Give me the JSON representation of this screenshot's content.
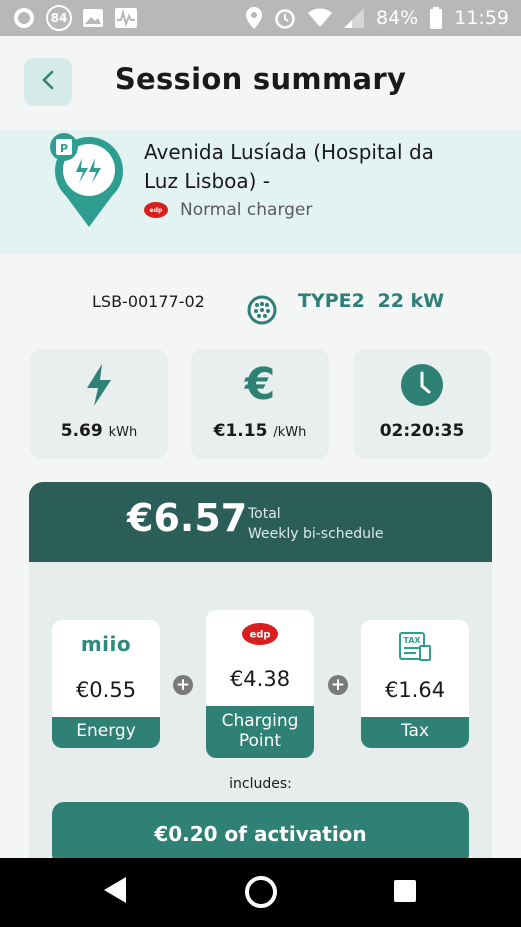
{
  "status_bar": {
    "notification_count": "84",
    "battery": "84%",
    "time": "11:59"
  },
  "header": {
    "title": "Session summary"
  },
  "station": {
    "name_line1": "Avenida Lusíada (Hospital da",
    "name_line2": "Luz Lisboa) -",
    "operator_logo": "edp",
    "charger_type": "Normal charger"
  },
  "connector": {
    "charger_id": "LSB-00177-02",
    "plug_type": "TYPE2",
    "power": "22 kW"
  },
  "stats": {
    "energy_value": "5.69",
    "energy_unit": "kWh",
    "price_value": "€1.15",
    "price_unit": "/kWh",
    "duration": "02:20:35"
  },
  "total": {
    "amount": "€6.57",
    "label": "Total",
    "tariff": "Weekly bi-schedule"
  },
  "breakdown": [
    {
      "logo": "miio",
      "value": "€0.55",
      "label": "Energy"
    },
    {
      "logo": "edp",
      "value": "€4.38",
      "label_line1": "Charging",
      "label_line2": "Point"
    },
    {
      "logo": "TAX",
      "value": "€1.64",
      "label": "Tax"
    }
  ],
  "includes_label": "includes:",
  "activation_label": "€0.20 of activation",
  "colors": {
    "accent": "#2f8075",
    "dark_accent": "#2b5e58",
    "station_bg": "#e3f3f2",
    "brand_red": "#d91e1e"
  }
}
